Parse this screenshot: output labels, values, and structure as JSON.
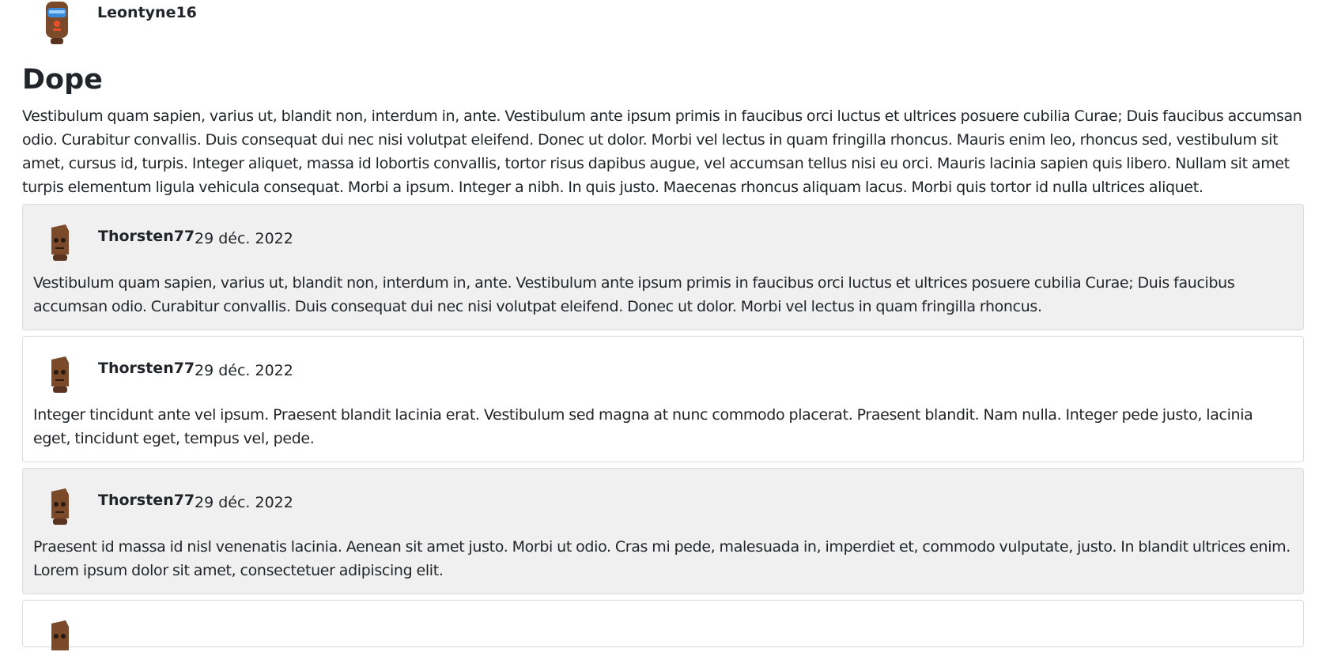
{
  "post": {
    "author": "Leontyne16",
    "title": "Dope",
    "body": "Vestibulum quam sapien, varius ut, blandit non, interdum in, ante. Vestibulum ante ipsum primis in faucibus orci luctus et ultrices posuere cubilia Curae; Duis faucibus accumsan odio. Curabitur convallis. Duis consequat dui nec nisi volutpat eleifend. Donec ut dolor. Morbi vel lectus in quam fringilla rhoncus. Mauris enim leo, rhoncus sed, vestibulum sit amet, cursus id, turpis. Integer aliquet, massa id lobortis convallis, tortor risus dapibus augue, vel accumsan tellus nisi eu orci. Mauris lacinia sapien quis libero. Nullam sit amet turpis elementum ligula vehicula consequat. Morbi a ipsum. Integer a nibh. In quis justo. Maecenas rhoncus aliquam lacus. Morbi quis tortor id nulla ultrices aliquet."
  },
  "comments": [
    {
      "user": "Thorsten77",
      "date": "29 déc. 2022",
      "text": "Vestibulum quam sapien, varius ut, blandit non, interdum in, ante. Vestibulum ante ipsum primis in faucibus orci luctus et ultrices posuere cubilia Curae; Duis faucibus accumsan odio. Curabitur convallis. Duis consequat dui nec nisi volutpat eleifend. Donec ut dolor. Morbi vel lectus in quam fringilla rhoncus."
    },
    {
      "user": "Thorsten77",
      "date": "29 déc. 2022",
      "text": "Integer tincidunt ante vel ipsum. Praesent blandit lacinia erat. Vestibulum sed magna at nunc commodo placerat. Praesent blandit. Nam nulla. Integer pede justo, lacinia eget, tincidunt eget, tempus vel, pede."
    },
    {
      "user": "Thorsten77",
      "date": "29 déc. 2022",
      "text": "Praesent id massa id nisl venenatis lacinia. Aenean sit amet justo. Morbi ut odio. Cras mi pede, malesuada in, imperdiet et, commodo vulputate, justo. In blandit ultrices enim. Lorem ipsum dolor sit amet, consectetuer adipiscing elit."
    }
  ],
  "colors": {
    "text": "#212529",
    "comment_shaded_bg": "#f0f0f0",
    "comment_border": "#dcdcdc",
    "avatar_brown": "#7a4a2a"
  },
  "icons": {
    "post_avatar": "robot-avatar-icon",
    "comment_avatar": "robot-avatar-icon"
  }
}
